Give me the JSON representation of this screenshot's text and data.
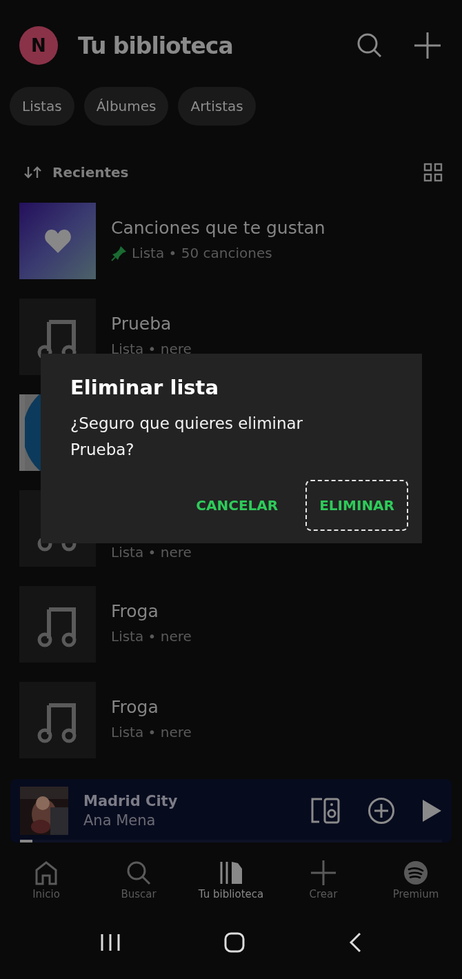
{
  "header": {
    "avatar": "N",
    "title": "Tu biblioteca"
  },
  "filters": [
    {
      "label": "Listas",
      "selected": false
    },
    {
      "label": "Álbumes",
      "selected": false
    },
    {
      "label": "Artistas",
      "selected": false
    }
  ],
  "sort": {
    "label": "Recientes"
  },
  "items": [
    {
      "kind": "liked",
      "title": "Canciones que te gustan",
      "subtitle": "Lista • 50 canciones",
      "pinned": true
    },
    {
      "kind": "playlist",
      "title": "Prueba",
      "subtitle": "Lista • nere",
      "pinned": false
    },
    {
      "kind": "picture"
    },
    {
      "kind": "playlist",
      "subtitle": "Lista • nere",
      "pinned": false
    },
    {
      "kind": "playlist",
      "title": "Froga",
      "subtitle": "Lista • nere",
      "pinned": false
    },
    {
      "kind": "playlist",
      "title": "Froga",
      "subtitle": "Lista • nere",
      "pinned": false
    }
  ],
  "now_playing": {
    "title": "Madrid City",
    "artist": "Ana Mena",
    "level": 0.03
  },
  "nav": [
    {
      "label": "Inicio",
      "selected": false
    },
    {
      "label": "Buscar",
      "selected": false
    },
    {
      "label": "Tu biblioteca",
      "selected": true
    },
    {
      "label": "Crear",
      "selected": false
    },
    {
      "label": "Premium",
      "selected": false
    }
  ],
  "dialog": {
    "title": "Eliminar lista",
    "message": "¿Seguro que quieres eliminar Prueba?",
    "buttons": [
      {
        "label": "CANCELAR",
        "focused": false
      },
      {
        "label": "ELIMINAR",
        "focused": true
      }
    ]
  }
}
